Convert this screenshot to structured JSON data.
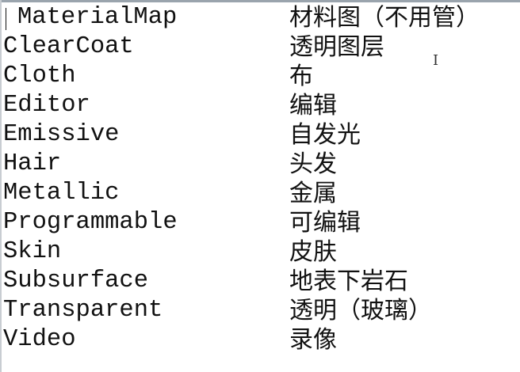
{
  "rows": [
    {
      "key": "MaterialMap",
      "value": "材料图（不用管）"
    },
    {
      "key": "ClearCoat",
      "value": "透明图层"
    },
    {
      "key": "Cloth",
      "value": "布"
    },
    {
      "key": "Editor",
      "value": "编辑"
    },
    {
      "key": "Emissive",
      "value": "自发光"
    },
    {
      "key": "Hair",
      "value": "头发"
    },
    {
      "key": "Metallic",
      "value": "金属"
    },
    {
      "key": "Programmable",
      "value": "可编辑"
    },
    {
      "key": "Skin",
      "value": "皮肤"
    },
    {
      "key": "Subsurface",
      "value": "地表下岩石"
    },
    {
      "key": "Transparent",
      "value": "透明（玻璃）"
    },
    {
      "key": "Video",
      "value": "录像"
    }
  ],
  "cursor": {
    "icon": "text-cursor-icon"
  }
}
